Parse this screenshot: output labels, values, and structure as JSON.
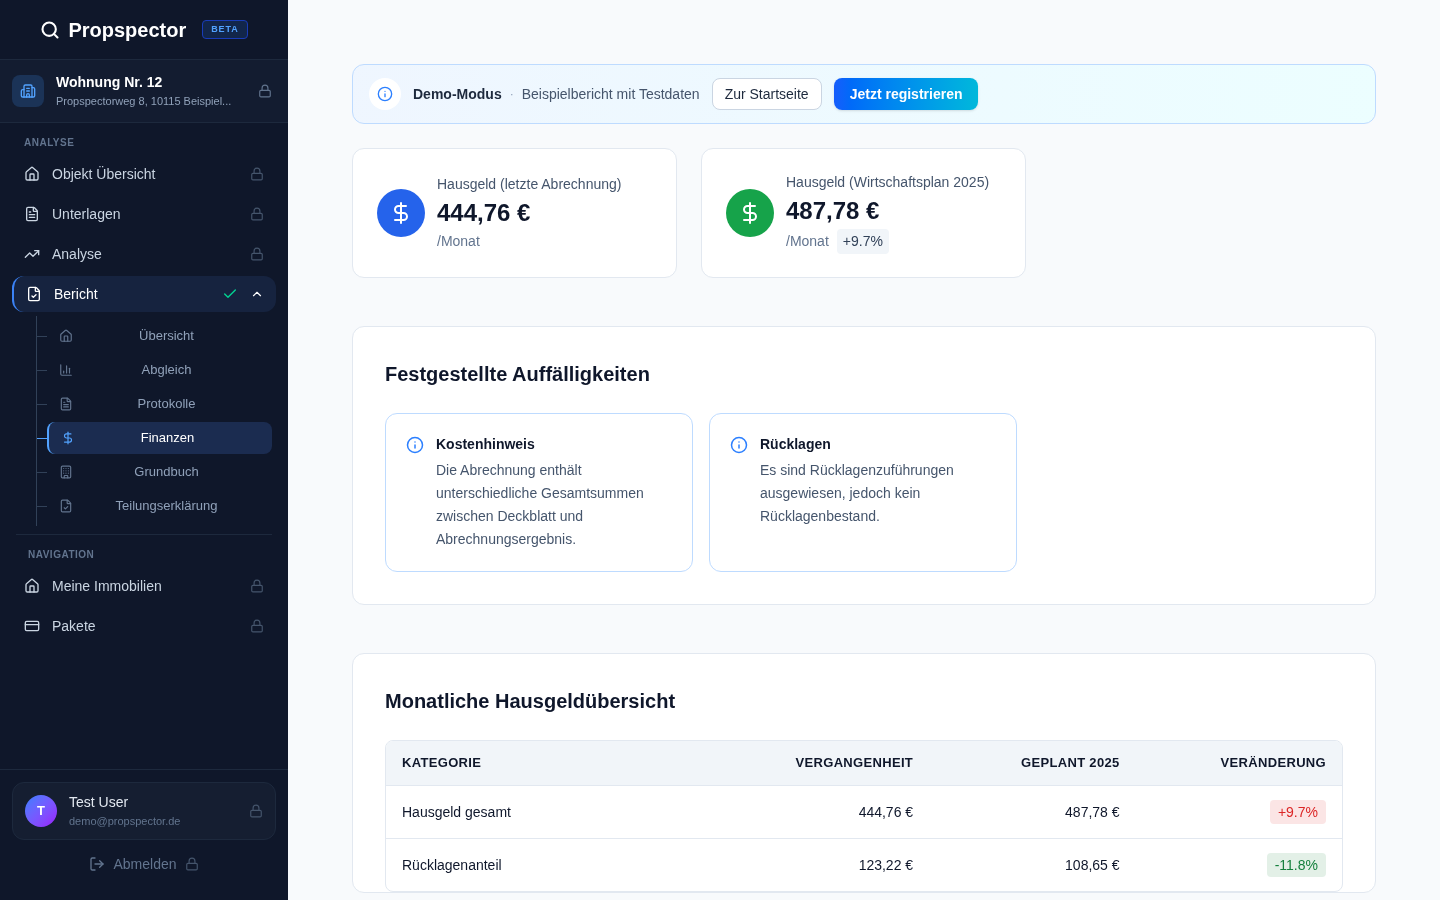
{
  "brand": {
    "name": "Propspector",
    "badge": "BETA"
  },
  "property": {
    "title": "Wohnung Nr. 12",
    "address": "Propspectorweg 8, 10115 Beispiel...",
    "locked": true
  },
  "sections": [
    {
      "heading": "ANALYSE",
      "items": [
        {
          "label": "Objekt Übersicht",
          "locked": true,
          "selected": false
        },
        {
          "label": "Unterlagen",
          "locked": true,
          "selected": false
        },
        {
          "label": "Analyse",
          "locked": true,
          "selected": false
        },
        {
          "label": "Bericht",
          "selected": true,
          "done": true,
          "expanded": true,
          "children": [
            {
              "label": "Übersicht",
              "selected": false
            },
            {
              "label": "Abgleich",
              "selected": false
            },
            {
              "label": "Protokolle",
              "selected": false
            },
            {
              "label": "Finanzen",
              "selected": true
            },
            {
              "label": "Grundbuch",
              "selected": false
            },
            {
              "label": "Teilungserklärung",
              "selected": false
            }
          ]
        }
      ]
    },
    {
      "heading": "NAVIGATION",
      "items": [
        {
          "label": "Meine Immobilien",
          "locked": true,
          "selected": false
        },
        {
          "label": "Pakete",
          "locked": true,
          "selected": false
        }
      ]
    }
  ],
  "user": {
    "initial": "T",
    "name": "Test User",
    "email": "demo@propspector.de",
    "locked": true
  },
  "logout": {
    "label": "Abmelden",
    "locked": true
  },
  "banner": {
    "title": "Demo-Modus",
    "separator": "·",
    "text": "Beispielbericht mit Testdaten",
    "buttons": [
      "Zur Startseite",
      "Jetzt registrieren"
    ]
  },
  "stats": [
    {
      "label": "Hausgeld (letzte Abrechnung)",
      "value": "444,76 €",
      "unit": "/Monat",
      "color": "#2563eb"
    },
    {
      "label": "Hausgeld (Wirtschaftsplan 2025)",
      "value": "487,78 €",
      "unit": "/Monat",
      "color": "#16a34a",
      "change": "+9.7%"
    }
  ],
  "findings": {
    "title": "Festgestellte Auffälligkeiten",
    "items": [
      {
        "title": "Kostenhinweis",
        "text": "Die Abrechnung enthält unterschiedliche Gesamtsummen zwischen Deckblatt und Abrechnungsergebnis."
      },
      {
        "title": "Rücklagen",
        "text": "Es sind Rücklagenzuführungen ausgewiesen, jedoch kein Rücklagenbestand."
      }
    ]
  },
  "overview": {
    "title": "Monatliche Hausgeldübersicht",
    "columns": [
      "KATEGORIE",
      "VERGANGENHEIT",
      "GEPLANT 2025",
      "VERÄNDERUNG"
    ],
    "rows": [
      {
        "category": "Hausgeld gesamt",
        "past": "444,76 €",
        "planned": "487,78 €",
        "change": "+9.7%",
        "color": "#dc2626"
      },
      {
        "category": "Rücklagenanteil",
        "past": "123,22 €",
        "planned": "108,65 €",
        "change": "-11.8%",
        "color": "#15803d"
      }
    ]
  }
}
